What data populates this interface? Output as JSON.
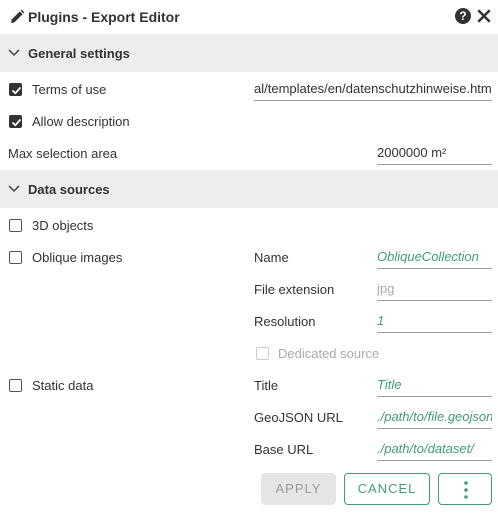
{
  "window": {
    "title": "Plugins - Export Editor",
    "help_glyph": "?"
  },
  "general": {
    "heading": "General settings",
    "terms_label": "Terms of use",
    "terms_checked": true,
    "terms_value": "al/templates/en/datenschutzhinweise.html",
    "allow_label": "Allow description",
    "allow_checked": true,
    "max_area_label": "Max selection area",
    "max_area_value": "2000000 m²"
  },
  "sources": {
    "heading": "Data sources",
    "objects_label": "3D objects",
    "objects_checked": false,
    "oblique": {
      "label": "Oblique images",
      "checked": false,
      "name_label": "Name",
      "name_value": "ObliqueCollection",
      "ext_label": "File extension",
      "ext_placeholder": "jpg",
      "res_label": "Resolution",
      "res_value": "1",
      "dedicated_label": "Dedicated source",
      "dedicated_checked": false
    },
    "static": {
      "label": "Static data",
      "checked": false,
      "title_label": "Title",
      "title_value": "Title",
      "geojson_label": "GeoJSON URL",
      "geojson_value": "./path/to/file.geojson",
      "base_label": "Base URL",
      "base_value": "./path/to/dataset/"
    }
  },
  "actions": {
    "apply": "APPLY",
    "cancel": "CANCEL"
  },
  "icons": {
    "edit": "pencil-icon",
    "help": "help-icon",
    "close": "close-icon",
    "collapse": "chevron-down-icon",
    "more": "more-vert-icon"
  },
  "colors": {
    "accent": "#409d76",
    "section_bg": "#ededed",
    "text": "#333333",
    "disabled_text": "#aaaaaa"
  }
}
